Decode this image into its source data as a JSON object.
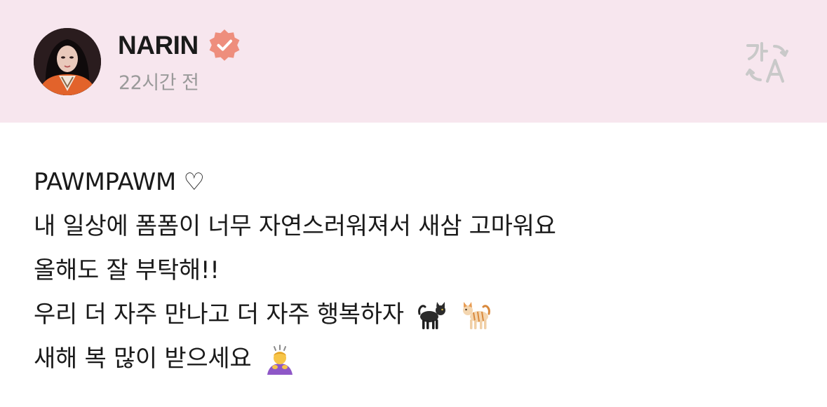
{
  "header": {
    "author_name": "NARIN",
    "timestamp": "22시간 전",
    "verified_color": "#ee8e7d",
    "background_color": "#f7e6ee"
  },
  "icons": {
    "verified": "verified-badge-icon",
    "translate": "translate-icon",
    "heart": "heart-outline-icon",
    "black_cat": "black-cat-emoji",
    "cat": "cat-emoji",
    "person_bowing": "person-bowing-emoji"
  },
  "post": {
    "lines": [
      "PAWMPAWM ♡",
      "내 일상에 폼폼이 너무 자연스러워져서 새삼 고마워요",
      "올해도 잘 부탁해!!",
      "우리 더 자주 만나고 더 자주 행복하자",
      "새해 복 많이 받으세요"
    ]
  }
}
